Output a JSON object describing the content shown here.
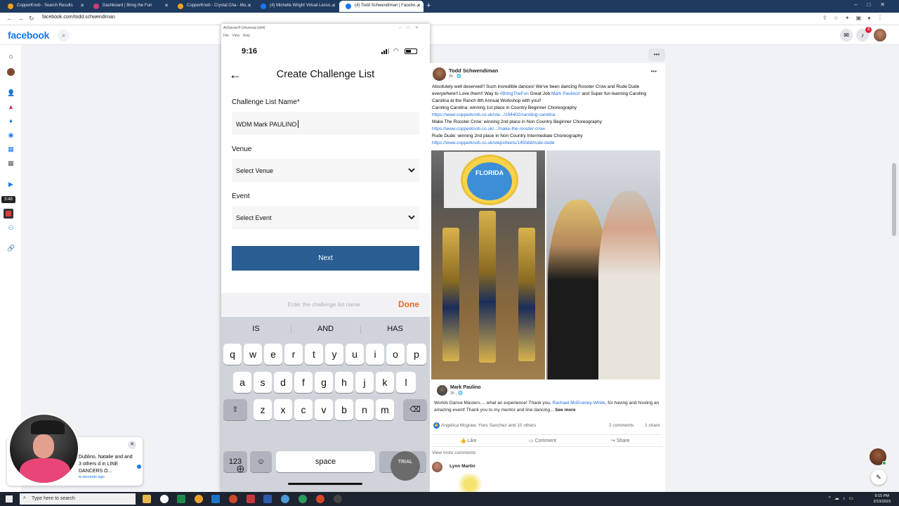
{
  "browser": {
    "tabs": [
      {
        "label": "CopperKnob - Search Results",
        "icon_color": "#f4a020"
      },
      {
        "label": "Dashboard | Bring the Fun",
        "icon_color": "#d13a7a"
      },
      {
        "label": "CopperKnob - Crystal Cha - Mu...",
        "icon_color": "#f4a020"
      },
      {
        "label": "(4) Michelle Wright Virtual Lesso...",
        "icon_color": "#1877f2"
      },
      {
        "label": "(4) Todd Schwendiman | Facebo...",
        "icon_color": "#1877f2"
      }
    ],
    "url": "facebook.com/todd.schwendiman"
  },
  "facebook": {
    "logo": "facebook",
    "notification_count": "3",
    "timer": "3:48"
  },
  "simulator": {
    "window_title": "AirServer® Universal (x64)",
    "menu": [
      "File",
      "View",
      "Help"
    ],
    "status_time": "9:16",
    "screen_title": "Create Challenge List",
    "challenge_label": "Challenge List Name*",
    "challenge_value": "WDM Mark PAULINO",
    "venue_label": "Venue",
    "venue_value": "Select Venue",
    "event_label": "Event",
    "event_value": "Select Event",
    "next_label": "Next",
    "kb_hint": "Enter the challenge list name",
    "kb_done": "Done",
    "suggestions": [
      "IS",
      "AND",
      "HAS"
    ],
    "row1": [
      "q",
      "w",
      "e",
      "r",
      "t",
      "y",
      "u",
      "i",
      "o",
      "p"
    ],
    "row2": [
      "a",
      "s",
      "d",
      "f",
      "g",
      "h",
      "j",
      "k",
      "l"
    ],
    "row3": [
      "z",
      "x",
      "c",
      "v",
      "b",
      "n",
      "m"
    ],
    "key_123": "123",
    "key_space": "space",
    "key_return": "return",
    "trial_label": "TRIAL"
  },
  "post": {
    "author": "Todd Schwendiman",
    "meta": "3h · ",
    "text_1": "Absolutely well deserved!!  Such incredible dances! We've been dancing Rooster Crow and Rude Dude everywhere!!  Love them!!  Way to ",
    "hashtag": "#BringTheFun",
    "text_2": " Great Job ",
    "mention": "Mark Paulino!!",
    "text_3": "  and Super fun learning Caroling Carolina at the Ranch 8th Annual Workshop with you!!",
    "line_caroling": "Caroling Carolina: winning 1st place in Country Beginner Choreography",
    "link_caroling": "https://www.copperknob.co.uk/ste.../164402/caroling-carolina",
    "line_rooster": "Make The Rooster Crow: winning 2nd place in Non Country Beginner Choreography",
    "link_rooster": "https://www.copperknob.co.uk/.../make-the-rooster-crow",
    "line_rude": "Rude Dude: winning 2nd place in Non Country Intermediate Choreography",
    "link_rude": "https://www.copperknob.co.uk/stepsheets/145588/rude-dude",
    "photo_logo_text": "FLORIDA"
  },
  "shared": {
    "author": "Mark Paulino",
    "meta": "3h · ",
    "text_1": "Worlds Dance Masters.... what an experience! Thank you, ",
    "mention": "Rachael McEnaney-White",
    "text_2": ", for having and hosting an amazing event! Thank you to my mentor and line dancing... ",
    "see_more": "See more"
  },
  "engagement": {
    "reactions": "Angelica Mcgraw, Yves Sanchez and 10 others",
    "comments": "2 comments",
    "shares": "1 share",
    "like": "Like",
    "comment": "Comment",
    "share": "Share",
    "view_more": "View more comments",
    "commenter": "Lynn Martin"
  },
  "notification": {
    "text": "Dublino, Natalie and and 3 others d in LINE DANCERS O...",
    "time": "w seconds ago"
  },
  "taskbar": {
    "search_placeholder": "Type here to search",
    "time": "9:15 PM",
    "date": "2/19/2023"
  }
}
